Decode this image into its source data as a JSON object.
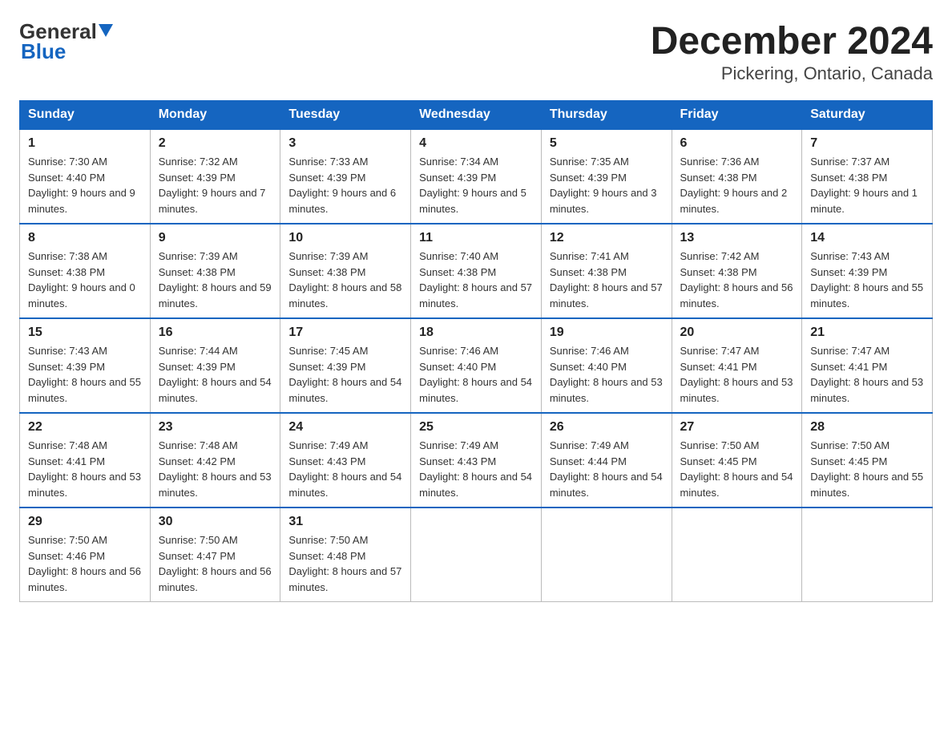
{
  "header": {
    "logo_general": "General",
    "logo_blue": "Blue",
    "title": "December 2024",
    "subtitle": "Pickering, Ontario, Canada"
  },
  "weekdays": [
    "Sunday",
    "Monday",
    "Tuesday",
    "Wednesday",
    "Thursday",
    "Friday",
    "Saturday"
  ],
  "weeks": [
    [
      {
        "day": "1",
        "sunrise": "7:30 AM",
        "sunset": "4:40 PM",
        "daylight": "9 hours and 9 minutes."
      },
      {
        "day": "2",
        "sunrise": "7:32 AM",
        "sunset": "4:39 PM",
        "daylight": "9 hours and 7 minutes."
      },
      {
        "day": "3",
        "sunrise": "7:33 AM",
        "sunset": "4:39 PM",
        "daylight": "9 hours and 6 minutes."
      },
      {
        "day": "4",
        "sunrise": "7:34 AM",
        "sunset": "4:39 PM",
        "daylight": "9 hours and 5 minutes."
      },
      {
        "day": "5",
        "sunrise": "7:35 AM",
        "sunset": "4:39 PM",
        "daylight": "9 hours and 3 minutes."
      },
      {
        "day": "6",
        "sunrise": "7:36 AM",
        "sunset": "4:38 PM",
        "daylight": "9 hours and 2 minutes."
      },
      {
        "day": "7",
        "sunrise": "7:37 AM",
        "sunset": "4:38 PM",
        "daylight": "9 hours and 1 minute."
      }
    ],
    [
      {
        "day": "8",
        "sunrise": "7:38 AM",
        "sunset": "4:38 PM",
        "daylight": "9 hours and 0 minutes."
      },
      {
        "day": "9",
        "sunrise": "7:39 AM",
        "sunset": "4:38 PM",
        "daylight": "8 hours and 59 minutes."
      },
      {
        "day": "10",
        "sunrise": "7:39 AM",
        "sunset": "4:38 PM",
        "daylight": "8 hours and 58 minutes."
      },
      {
        "day": "11",
        "sunrise": "7:40 AM",
        "sunset": "4:38 PM",
        "daylight": "8 hours and 57 minutes."
      },
      {
        "day": "12",
        "sunrise": "7:41 AM",
        "sunset": "4:38 PM",
        "daylight": "8 hours and 57 minutes."
      },
      {
        "day": "13",
        "sunrise": "7:42 AM",
        "sunset": "4:38 PM",
        "daylight": "8 hours and 56 minutes."
      },
      {
        "day": "14",
        "sunrise": "7:43 AM",
        "sunset": "4:39 PM",
        "daylight": "8 hours and 55 minutes."
      }
    ],
    [
      {
        "day": "15",
        "sunrise": "7:43 AM",
        "sunset": "4:39 PM",
        "daylight": "8 hours and 55 minutes."
      },
      {
        "day": "16",
        "sunrise": "7:44 AM",
        "sunset": "4:39 PM",
        "daylight": "8 hours and 54 minutes."
      },
      {
        "day": "17",
        "sunrise": "7:45 AM",
        "sunset": "4:39 PM",
        "daylight": "8 hours and 54 minutes."
      },
      {
        "day": "18",
        "sunrise": "7:46 AM",
        "sunset": "4:40 PM",
        "daylight": "8 hours and 54 minutes."
      },
      {
        "day": "19",
        "sunrise": "7:46 AM",
        "sunset": "4:40 PM",
        "daylight": "8 hours and 53 minutes."
      },
      {
        "day": "20",
        "sunrise": "7:47 AM",
        "sunset": "4:41 PM",
        "daylight": "8 hours and 53 minutes."
      },
      {
        "day": "21",
        "sunrise": "7:47 AM",
        "sunset": "4:41 PM",
        "daylight": "8 hours and 53 minutes."
      }
    ],
    [
      {
        "day": "22",
        "sunrise": "7:48 AM",
        "sunset": "4:41 PM",
        "daylight": "8 hours and 53 minutes."
      },
      {
        "day": "23",
        "sunrise": "7:48 AM",
        "sunset": "4:42 PM",
        "daylight": "8 hours and 53 minutes."
      },
      {
        "day": "24",
        "sunrise": "7:49 AM",
        "sunset": "4:43 PM",
        "daylight": "8 hours and 54 minutes."
      },
      {
        "day": "25",
        "sunrise": "7:49 AM",
        "sunset": "4:43 PM",
        "daylight": "8 hours and 54 minutes."
      },
      {
        "day": "26",
        "sunrise": "7:49 AM",
        "sunset": "4:44 PM",
        "daylight": "8 hours and 54 minutes."
      },
      {
        "day": "27",
        "sunrise": "7:50 AM",
        "sunset": "4:45 PM",
        "daylight": "8 hours and 54 minutes."
      },
      {
        "day": "28",
        "sunrise": "7:50 AM",
        "sunset": "4:45 PM",
        "daylight": "8 hours and 55 minutes."
      }
    ],
    [
      {
        "day": "29",
        "sunrise": "7:50 AM",
        "sunset": "4:46 PM",
        "daylight": "8 hours and 56 minutes."
      },
      {
        "day": "30",
        "sunrise": "7:50 AM",
        "sunset": "4:47 PM",
        "daylight": "8 hours and 56 minutes."
      },
      {
        "day": "31",
        "sunrise": "7:50 AM",
        "sunset": "4:48 PM",
        "daylight": "8 hours and 57 minutes."
      },
      null,
      null,
      null,
      null
    ]
  ],
  "labels": {
    "sunrise": "Sunrise:",
    "sunset": "Sunset:",
    "daylight": "Daylight:"
  }
}
